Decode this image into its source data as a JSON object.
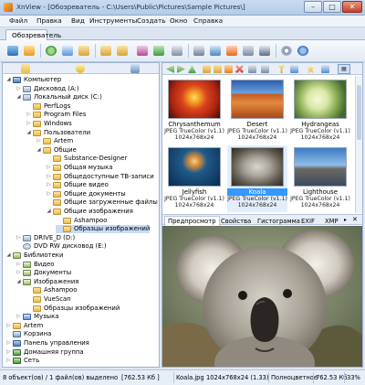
{
  "window": {
    "title": "XnView - [Обозреватель - C:\\Users\\Public\\Pictures\\Sample Pictures\\]",
    "minimize_glyph": "–",
    "maximize_glyph": "□",
    "close_glyph": "✕"
  },
  "menu": [
    "Файл",
    "Правка",
    "Вид",
    "Инструменты",
    "Создать",
    "Окно",
    "Справка"
  ],
  "tab": {
    "label": "Обозреватель"
  },
  "tree": [
    {
      "label": "Компьютер",
      "icon": "computer-icon",
      "level": 0,
      "exp": "minus"
    },
    {
      "label": "Дисковод (A:)",
      "icon": "floppy-drive-icon",
      "level": 1,
      "exp": "plus"
    },
    {
      "label": "Локальный диск (C:)",
      "icon": "local-disk-icon",
      "level": 1,
      "exp": "minus"
    },
    {
      "label": "PerfLogs",
      "icon": "folder-icon",
      "level": 2,
      "exp": ""
    },
    {
      "label": "Program Files",
      "icon": "folder-icon",
      "level": 2,
      "exp": "plus"
    },
    {
      "label": "Windows",
      "icon": "folder-icon",
      "level": 2,
      "exp": "plus"
    },
    {
      "label": "Пользователи",
      "icon": "folder-icon",
      "level": 2,
      "exp": "minus"
    },
    {
      "label": "Artem",
      "icon": "folder-icon",
      "level": 3,
      "exp": "plus"
    },
    {
      "label": "Общие",
      "icon": "folder-icon",
      "level": 3,
      "exp": "minus"
    },
    {
      "label": "Substance-Designer",
      "icon": "folder-icon",
      "level": 4,
      "exp": ""
    },
    {
      "label": "Общая музыка",
      "icon": "folder-icon",
      "level": 4,
      "exp": "plus"
    },
    {
      "label": "Общедоступные ТВ-записи",
      "icon": "folder-icon",
      "level": 4,
      "exp": "plus"
    },
    {
      "label": "Общие видео",
      "icon": "folder-icon",
      "level": 4,
      "exp": "plus"
    },
    {
      "label": "Общие документы",
      "icon": "folder-icon",
      "level": 4,
      "exp": "plus"
    },
    {
      "label": "Общие загруженные файлы",
      "icon": "folder-icon",
      "level": 4,
      "exp": ""
    },
    {
      "label": "Общие изображения",
      "icon": "folder-icon",
      "level": 4,
      "exp": "minus"
    },
    {
      "label": "Ashampoo",
      "icon": "folder-icon",
      "level": 5,
      "exp": ""
    },
    {
      "label": "Образцы изображений",
      "icon": "folder-icon",
      "level": 5,
      "exp": "",
      "selected": true
    },
    {
      "label": "DRIVE_D (D:)",
      "icon": "drive-d-icon",
      "level": 1,
      "exp": "plus"
    },
    {
      "label": "DVD RW дисковод (E:)",
      "icon": "dvd-drive-icon",
      "level": 1,
      "exp": ""
    },
    {
      "label": "Библиотеки",
      "icon": "libraries-icon",
      "level": 0,
      "exp": "minus"
    },
    {
      "label": "Видео",
      "icon": "video-library-icon",
      "level": 1,
      "exp": "plus"
    },
    {
      "label": "Документы",
      "icon": "documents-library-icon",
      "level": 1,
      "exp": "plus"
    },
    {
      "label": "Изображения",
      "icon": "pictures-library-icon",
      "level": 1,
      "exp": "minus"
    },
    {
      "label": "Ashampoo",
      "icon": "folder-icon",
      "level": 2,
      "exp": ""
    },
    {
      "label": "VueScan",
      "icon": "folder-icon",
      "level": 2,
      "exp": ""
    },
    {
      "label": "Образцы изображений",
      "icon": "folder-icon",
      "level": 2,
      "exp": ""
    },
    {
      "label": "Музыка",
      "icon": "music-library-icon",
      "level": 1,
      "exp": "plus"
    },
    {
      "label": "Artem",
      "icon": "user-folder-icon",
      "level": 0,
      "exp": "plus"
    },
    {
      "label": "Корзина",
      "icon": "recycle-bin-icon",
      "level": 0,
      "exp": ""
    },
    {
      "label": "Панель управления",
      "icon": "control-panel-icon",
      "level": 0,
      "exp": "plus"
    },
    {
      "label": "Домашняя группа",
      "icon": "homegroup-icon",
      "level": 0,
      "exp": "plus"
    },
    {
      "label": "Сеть",
      "icon": "network-icon",
      "level": 0,
      "exp": "plus"
    }
  ],
  "thumbnails": [
    {
      "name": "Chrysanthemum",
      "format": "JPEG TrueColor (v1.1)",
      "size": "1024x768x24"
    },
    {
      "name": "Desert",
      "format": "JPEG TrueColor (v1.1)",
      "size": "1024x768x24"
    },
    {
      "name": "Hydrangeas",
      "format": "JPEG TrueColor (v1.1)",
      "size": "1024x768x24"
    },
    {
      "name": "Jellyfish",
      "format": "JPEG TrueColor (v1.1)",
      "size": "1024x768x24"
    },
    {
      "name": "Koala",
      "format": "JPEG TrueColor (v1.1)",
      "size": "1024x768x24",
      "selected": true
    },
    {
      "name": "Lighthouse",
      "format": "JPEG TrueColor (v1.1)",
      "size": "1024x768x24"
    }
  ],
  "preview_tabs": [
    "Предпросмотр",
    "Свойства",
    "Гистограмма",
    "EXIF",
    "XMP"
  ],
  "preview_tab_glyphs": {
    "more": "▸",
    "close": "✕"
  },
  "nav_view_mode": "▤",
  "status": {
    "objects": "8 объект(ов) / 1 файл(ов) выделено",
    "selected_size": "[762.53 Кб ]",
    "filename": "Koala.jpg",
    "dimensions": "1024x768x24 (1.33)",
    "color_mode": "Полноцветное",
    "file_size": "762.53 Кб",
    "zoom": "33%"
  }
}
